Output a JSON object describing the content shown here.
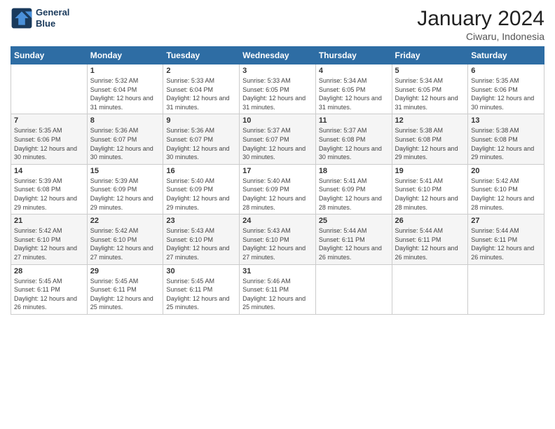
{
  "logo": {
    "line1": "General",
    "line2": "Blue"
  },
  "title": "January 2024",
  "subtitle": "Ciwaru, Indonesia",
  "headers": [
    "Sunday",
    "Monday",
    "Tuesday",
    "Wednesday",
    "Thursday",
    "Friday",
    "Saturday"
  ],
  "weeks": [
    [
      {
        "day": "",
        "info": ""
      },
      {
        "day": "1",
        "info": "Sunrise: 5:32 AM\nSunset: 6:04 PM\nDaylight: 12 hours\nand 31 minutes."
      },
      {
        "day": "2",
        "info": "Sunrise: 5:33 AM\nSunset: 6:04 PM\nDaylight: 12 hours\nand 31 minutes."
      },
      {
        "day": "3",
        "info": "Sunrise: 5:33 AM\nSunset: 6:05 PM\nDaylight: 12 hours\nand 31 minutes."
      },
      {
        "day": "4",
        "info": "Sunrise: 5:34 AM\nSunset: 6:05 PM\nDaylight: 12 hours\nand 31 minutes."
      },
      {
        "day": "5",
        "info": "Sunrise: 5:34 AM\nSunset: 6:05 PM\nDaylight: 12 hours\nand 31 minutes."
      },
      {
        "day": "6",
        "info": "Sunrise: 5:35 AM\nSunset: 6:06 PM\nDaylight: 12 hours\nand 30 minutes."
      }
    ],
    [
      {
        "day": "7",
        "info": "Sunrise: 5:35 AM\nSunset: 6:06 PM\nDaylight: 12 hours\nand 30 minutes."
      },
      {
        "day": "8",
        "info": "Sunrise: 5:36 AM\nSunset: 6:07 PM\nDaylight: 12 hours\nand 30 minutes."
      },
      {
        "day": "9",
        "info": "Sunrise: 5:36 AM\nSunset: 6:07 PM\nDaylight: 12 hours\nand 30 minutes."
      },
      {
        "day": "10",
        "info": "Sunrise: 5:37 AM\nSunset: 6:07 PM\nDaylight: 12 hours\nand 30 minutes."
      },
      {
        "day": "11",
        "info": "Sunrise: 5:37 AM\nSunset: 6:08 PM\nDaylight: 12 hours\nand 30 minutes."
      },
      {
        "day": "12",
        "info": "Sunrise: 5:38 AM\nSunset: 6:08 PM\nDaylight: 12 hours\nand 29 minutes."
      },
      {
        "day": "13",
        "info": "Sunrise: 5:38 AM\nSunset: 6:08 PM\nDaylight: 12 hours\nand 29 minutes."
      }
    ],
    [
      {
        "day": "14",
        "info": "Sunrise: 5:39 AM\nSunset: 6:08 PM\nDaylight: 12 hours\nand 29 minutes."
      },
      {
        "day": "15",
        "info": "Sunrise: 5:39 AM\nSunset: 6:09 PM\nDaylight: 12 hours\nand 29 minutes."
      },
      {
        "day": "16",
        "info": "Sunrise: 5:40 AM\nSunset: 6:09 PM\nDaylight: 12 hours\nand 29 minutes."
      },
      {
        "day": "17",
        "info": "Sunrise: 5:40 AM\nSunset: 6:09 PM\nDaylight: 12 hours\nand 28 minutes."
      },
      {
        "day": "18",
        "info": "Sunrise: 5:41 AM\nSunset: 6:09 PM\nDaylight: 12 hours\nand 28 minutes."
      },
      {
        "day": "19",
        "info": "Sunrise: 5:41 AM\nSunset: 6:10 PM\nDaylight: 12 hours\nand 28 minutes."
      },
      {
        "day": "20",
        "info": "Sunrise: 5:42 AM\nSunset: 6:10 PM\nDaylight: 12 hours\nand 28 minutes."
      }
    ],
    [
      {
        "day": "21",
        "info": "Sunrise: 5:42 AM\nSunset: 6:10 PM\nDaylight: 12 hours\nand 27 minutes."
      },
      {
        "day": "22",
        "info": "Sunrise: 5:42 AM\nSunset: 6:10 PM\nDaylight: 12 hours\nand 27 minutes."
      },
      {
        "day": "23",
        "info": "Sunrise: 5:43 AM\nSunset: 6:10 PM\nDaylight: 12 hours\nand 27 minutes."
      },
      {
        "day": "24",
        "info": "Sunrise: 5:43 AM\nSunset: 6:10 PM\nDaylight: 12 hours\nand 27 minutes."
      },
      {
        "day": "25",
        "info": "Sunrise: 5:44 AM\nSunset: 6:11 PM\nDaylight: 12 hours\nand 26 minutes."
      },
      {
        "day": "26",
        "info": "Sunrise: 5:44 AM\nSunset: 6:11 PM\nDaylight: 12 hours\nand 26 minutes."
      },
      {
        "day": "27",
        "info": "Sunrise: 5:44 AM\nSunset: 6:11 PM\nDaylight: 12 hours\nand 26 minutes."
      }
    ],
    [
      {
        "day": "28",
        "info": "Sunrise: 5:45 AM\nSunset: 6:11 PM\nDaylight: 12 hours\nand 26 minutes."
      },
      {
        "day": "29",
        "info": "Sunrise: 5:45 AM\nSunset: 6:11 PM\nDaylight: 12 hours\nand 25 minutes."
      },
      {
        "day": "30",
        "info": "Sunrise: 5:45 AM\nSunset: 6:11 PM\nDaylight: 12 hours\nand 25 minutes."
      },
      {
        "day": "31",
        "info": "Sunrise: 5:46 AM\nSunset: 6:11 PM\nDaylight: 12 hours\nand 25 minutes."
      },
      {
        "day": "",
        "info": ""
      },
      {
        "day": "",
        "info": ""
      },
      {
        "day": "",
        "info": ""
      }
    ]
  ]
}
